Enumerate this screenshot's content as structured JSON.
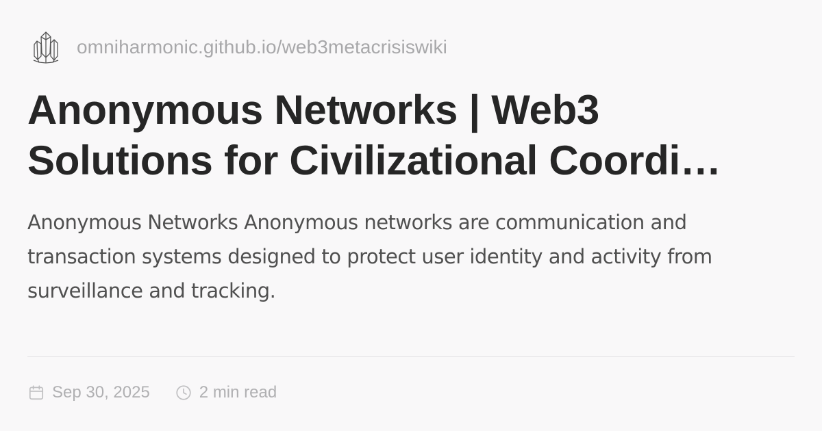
{
  "site": {
    "logo_icon": "crystal-cluster-icon",
    "url": "omniharmonic.github.io/web3metacrisiswiki"
  },
  "article": {
    "title_line_1": "Anonymous Networks | Web3",
    "title_line_2": "Solutions for Civilizational Coordi…",
    "description": "Anonymous Networks Anonymous networks are communication and transaction systems designed to protect user identity and activity from surveillance and tracking."
  },
  "meta": {
    "date_icon": "calendar-icon",
    "date": "Sep 30, 2025",
    "read_time_icon": "clock-icon",
    "read_time": "2 min read"
  },
  "colors": {
    "background": "#f9f8f9",
    "title": "#262626",
    "body_text": "#505050",
    "muted": "#a8a8aa",
    "divider": "#e4e3e5"
  }
}
